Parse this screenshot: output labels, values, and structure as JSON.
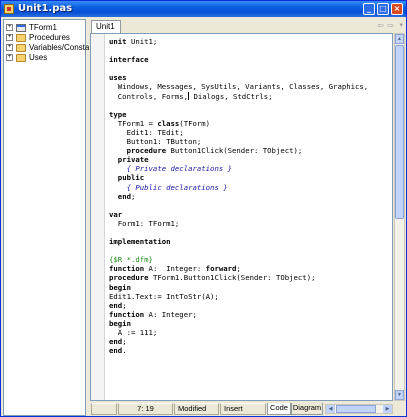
{
  "window": {
    "title": "Unit1.pas",
    "icon": "delphi-unit-icon",
    "controls": {
      "minimize": "_",
      "maximize": "□",
      "close": "×"
    }
  },
  "explorer": {
    "items": [
      {
        "label": "TForm1",
        "icon": "form-icon",
        "expander": "+"
      },
      {
        "label": "Procedures",
        "icon": "folder-icon",
        "expander": "+"
      },
      {
        "label": "Variables/Constants",
        "icon": "folder-icon",
        "expander": "+"
      },
      {
        "label": "Uses",
        "icon": "folder-icon",
        "expander": "+"
      }
    ]
  },
  "editor": {
    "tab": "Unit1",
    "nav": {
      "back": "⇦",
      "forward": "⇨",
      "dropdown": "▾"
    },
    "code_lines": [
      [
        "kw:unit",
        " Unit1;"
      ],
      [
        ""
      ],
      [
        "kw:interface"
      ],
      [
        ""
      ],
      [
        "kw:uses"
      ],
      [
        "  Windows, Messages, SysUtils, Variants, Classes, Graphics,"
      ],
      [
        "  Controls, Forms,",
        "caret",
        " Dialogs, StdCtrls;"
      ],
      [
        ""
      ],
      [
        "kw:type"
      ],
      [
        "  TForm1 = ",
        "kw:class",
        "(TForm)"
      ],
      [
        "    Edit1: TEdit;"
      ],
      [
        "    Button1: TButton;"
      ],
      [
        "    ",
        "kw:procedure",
        " Button1Click(Sender: TObject);"
      ],
      [
        "  ",
        "kw:private"
      ],
      [
        "    ",
        "cm:{ Private declarations }"
      ],
      [
        "  ",
        "kw:public"
      ],
      [
        "    ",
        "cm:{ Public declarations }"
      ],
      [
        "  ",
        "kw:end",
        ";"
      ],
      [
        ""
      ],
      [
        "kw:var"
      ],
      [
        "  Form1: TForm1;"
      ],
      [
        ""
      ],
      [
        "kw:implementation"
      ],
      [
        ""
      ],
      [
        "dir:{$R *.dfm}"
      ],
      [
        "kw:function",
        " A:  Integer: ",
        "kw:forward",
        ";"
      ],
      [
        "kw:procedure",
        " TForm1.Button1Click(Sender: TObject);"
      ],
      [
        "kw:begin"
      ],
      [
        "Edit1.Text:= IntToStr(A);"
      ],
      [
        "kw:end",
        ";"
      ],
      [
        "kw:function",
        " A: Integer;"
      ],
      [
        "kw:begin"
      ],
      [
        "  A := 111;"
      ],
      [
        "kw:end",
        ";"
      ],
      [
        "kw:end",
        "."
      ]
    ]
  },
  "statusbar": {
    "position": "7: 19",
    "modified": "Modified",
    "mode": "Insert",
    "tabs": [
      "Code",
      "Diagram"
    ]
  }
}
